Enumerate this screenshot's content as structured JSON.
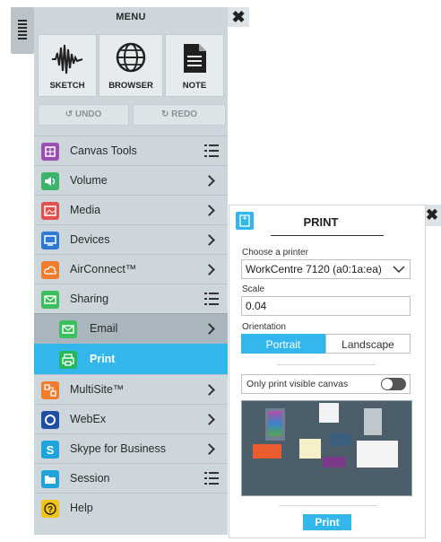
{
  "menu": {
    "title": "MENU",
    "close_glyph": "✖",
    "apps": [
      {
        "label": "SKETCH",
        "icon": "waveform-icon"
      },
      {
        "label": "BROWSER",
        "icon": "globe-icon"
      },
      {
        "label": "NOTE",
        "icon": "document-icon"
      }
    ],
    "undo_label": "UNDO",
    "redo_label": "REDO",
    "items": [
      {
        "label": "Canvas Tools",
        "icon_color": "#9b4fb3",
        "indicator": "list"
      },
      {
        "label": "Volume",
        "icon_color": "#3bb56a",
        "indicator": "chevron"
      },
      {
        "label": "Media",
        "icon_color": "#e0504f",
        "indicator": "chevron"
      },
      {
        "label": "Devices",
        "icon_color": "#2f79d6",
        "indicator": "chevron"
      },
      {
        "label": "AirConnect™",
        "icon_color": "#f07c2e",
        "indicator": "chevron"
      },
      {
        "label": "Sharing",
        "icon_color": "#3bbf5c",
        "indicator": "list"
      },
      {
        "label": "Email",
        "icon_color": "#3bbf5c",
        "indicator": "chevron"
      },
      {
        "label": "Print",
        "icon_color": "#27b65a",
        "indicator": "none"
      },
      {
        "label": "MultiSite™",
        "icon_color": "#f07c2e",
        "indicator": "chevron"
      },
      {
        "label": "WebEx",
        "icon_color": "#1e4fa3",
        "indicator": "chevron"
      },
      {
        "label": "Skype for Business",
        "icon_color": "#1ea3dc",
        "indicator": "chevron"
      },
      {
        "label": "Session",
        "icon_color": "#1ea3dc",
        "indicator": "list"
      },
      {
        "label": "Help",
        "icon_color": "#f2c417",
        "indicator": "none"
      }
    ]
  },
  "print": {
    "title": "PRINT",
    "close_glyph": "✖",
    "printer_label": "Choose a printer",
    "printer_value": "WorkCentre 7120 (a0:1a:ea)",
    "scale_label": "Scale",
    "scale_value": "0.04",
    "orientation_label": "Orientation",
    "orientation_options": [
      "Portrait",
      "Landscape"
    ],
    "orientation_selected": "Portrait",
    "visible_canvas_label": "Only print visible canvas",
    "visible_canvas_on": false,
    "print_button": "Print"
  },
  "colors": {
    "accent": "#33b6ec",
    "menu_bg": "#ccd6db",
    "sub_bg": "#a9b6bd"
  }
}
